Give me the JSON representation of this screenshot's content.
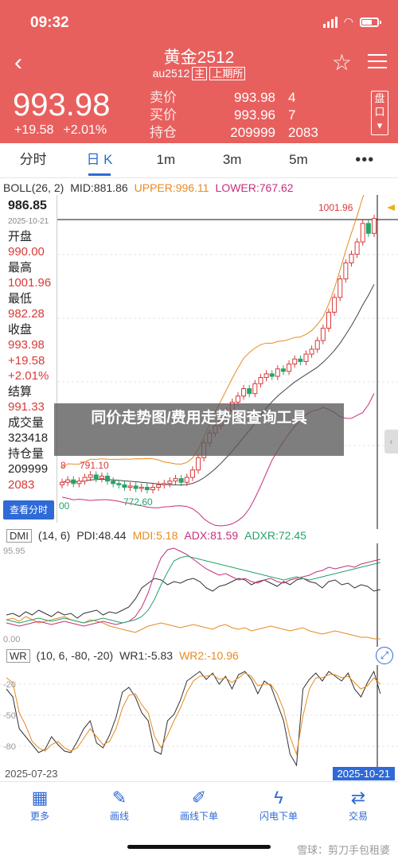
{
  "status": {
    "time": "09:32"
  },
  "header": {
    "title": "黄金2512",
    "code": "au2512",
    "tag_main": "主",
    "tag_exchange": "上期所",
    "price": "993.98",
    "change": "+19.58",
    "change_pct": "+2.01%",
    "pan_label": "盘口",
    "quotes": [
      {
        "label": "卖价",
        "value": "993.98",
        "qty": "4"
      },
      {
        "label": "买价",
        "value": "993.96",
        "qty": "7"
      },
      {
        "label": "持仓",
        "value": "209999",
        "qty": "2083"
      }
    ],
    "colors": {
      "header_bg": "#e8605e"
    }
  },
  "tabs": [
    {
      "label": "分时",
      "active": false
    },
    {
      "label": "日 K",
      "active": true
    },
    {
      "label": "1m",
      "active": false
    },
    {
      "label": "3m",
      "active": false
    },
    {
      "label": "5m",
      "active": false
    },
    {
      "label": "•••",
      "active": false
    }
  ],
  "boll": {
    "name": "BOLL(26, 2)",
    "mid": "MID:881.86",
    "upper": "UPPER:996.11",
    "lower": "LOWER:767.62"
  },
  "info_panel": {
    "crosshair_price": "986.85",
    "date": "2025-10-21",
    "open_label": "开盘",
    "open": "990.00",
    "high_label": "最高",
    "high": "1001.96",
    "low_label": "最低",
    "low": "982.28",
    "close_label": "收盘",
    "close": "993.98",
    "change": "+19.58",
    "change_pct": "+2.01%",
    "settle_label": "结算",
    "settle": "991.33",
    "volume_label": "成交量",
    "volume": "323418",
    "oi_label": "持仓量",
    "oi": "209999",
    "oi_change": "2083",
    "button": "查看分时"
  },
  "chart_labels": {
    "high_mark": "1001.96",
    "label_791": "791.10",
    "label_772": "772.60",
    "left_8": "8",
    "left_00": "00"
  },
  "dmi": {
    "name": "DMI",
    "params": "(14, 6)",
    "pdi": "PDI:48.44",
    "mdi": "MDI:5.18",
    "adx": "ADX:81.59",
    "adxr": "ADXR:72.45",
    "ymax": "95.95",
    "ymin": "0.00"
  },
  "wr": {
    "name": "WR",
    "params": "(10, 6, -80, -20)",
    "wr1": "WR1:-5.83",
    "wr2": "WR2:-10.96",
    "ticks": [
      "-20",
      "-50",
      "-80"
    ]
  },
  "dates": {
    "start": "2025-07-23",
    "end": "2025-10-21"
  },
  "watermark_title": "同价走势图/费用走势图查询工具",
  "bottom_nav": [
    {
      "label": "更多",
      "icon": "grid-icon"
    },
    {
      "label": "画线",
      "icon": "pen-line-icon"
    },
    {
      "label": "画线下单",
      "icon": "pen-order-icon"
    },
    {
      "label": "闪电下单",
      "icon": "lightning-icon"
    },
    {
      "label": "交易",
      "icon": "trade-icon"
    }
  ],
  "footer_watermark": "雪球：剪刀手包租婆",
  "chart_data": {
    "type": "candlestick",
    "x_range": [
      "2025-07-23",
      "2025-10-21"
    ],
    "ohlc_close_trend": [
      780,
      782,
      779,
      781,
      784,
      786,
      783,
      785,
      781,
      779,
      778,
      776,
      777,
      775,
      776,
      774,
      776,
      778,
      779,
      781,
      783,
      780,
      784,
      790,
      800,
      812,
      820,
      826,
      832,
      838,
      845,
      850,
      856,
      852,
      860,
      865,
      868,
      866,
      872,
      870,
      876,
      880,
      878,
      884,
      888,
      895,
      905,
      918,
      930,
      945,
      958,
      965,
      975,
      990,
      982,
      994
    ],
    "boll_upper_end": 996.11,
    "boll_mid_end": 881.86,
    "boll_lower_end": 767.62,
    "last_high": 1001.96,
    "last_close": 993.98
  }
}
